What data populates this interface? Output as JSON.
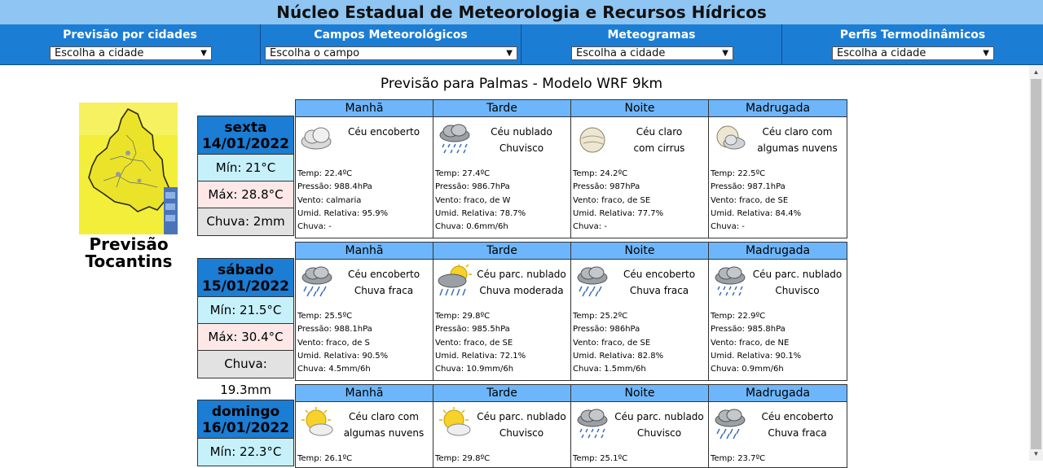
{
  "header": {
    "title": "Núcleo Estadual de Meteorologia e Recursos Hídricos"
  },
  "menu": [
    {
      "label": "Previsão por cidades",
      "select": "Escolha a cidade"
    },
    {
      "label": "Campos Meteorológicos",
      "select": "Escolha o campo"
    },
    {
      "label": "Meteogramas",
      "select": "Escolha a cidade"
    },
    {
      "label": "Perfis Termodinâmicos",
      "select": "Escolha a cidade"
    }
  ],
  "page_title": "Previsão para Palmas -  Modelo WRF 9km",
  "logo": {
    "line1": "Previsão",
    "line2": "Tocantins"
  },
  "periods": [
    "Manhã",
    "Tarde",
    "Noite",
    "Madrugada"
  ],
  "days": [
    {
      "name": "sexta",
      "date": "14/01/2022",
      "min": "Mín: 21°C",
      "max": "Máx: 28.8°C",
      "rain": "Chuva: 2mm",
      "periods": [
        {
          "icon": "overcast-cloud-icon",
          "cond1": "Céu encoberto",
          "cond2": "",
          "temp": "Temp: 22.4ºC",
          "pressure": "Pressão: 988.4hPa",
          "wind": "Vento: calmaria",
          "humidity": "Umid. Relativa: 95.9%",
          "rain": "Chuva: -"
        },
        {
          "icon": "drizzle-cloud-icon",
          "cond1": "Céu nublado",
          "cond2": "Chuvisco",
          "temp": "Temp: 27.4ºC",
          "pressure": "Pressão: 986.7hPa",
          "wind": "Vento: fraco, de W",
          "humidity": "Umid. Relativa: 78.7%",
          "rain": "Chuva: 0.6mm/6h"
        },
        {
          "icon": "cirrus-night-icon",
          "cond1": "Céu claro",
          "cond2": "com cirrus",
          "temp": "Temp: 24.2ºC",
          "pressure": "Pressão: 987hPa",
          "wind": "Vento: fraco, de SE",
          "humidity": "Umid. Relativa: 77.7%",
          "rain": "Chuva: -"
        },
        {
          "icon": "few-clouds-night-icon",
          "cond1": "Céu claro com",
          "cond2": "algumas nuvens",
          "temp": "Temp: 22.5ºC",
          "pressure": "Pressão: 987.1hPa",
          "wind": "Vento: fraco, de SE",
          "humidity": "Umid. Relativa: 84.4%",
          "rain": "Chuva: -"
        }
      ]
    },
    {
      "name": "sábado",
      "date": "15/01/2022",
      "min": "Mín: 21.5°C",
      "max": "Máx: 30.4°C",
      "rain": "Chuva: 19.3mm",
      "periods": [
        {
          "icon": "light-rain-cloud-icon",
          "cond1": "Céu encoberto",
          "cond2": "Chuva fraca",
          "temp": "Temp: 25.5ºC",
          "pressure": "Pressão: 988.1hPa",
          "wind": "Vento: fraco, de S",
          "humidity": "Umid. Relativa: 90.5%",
          "rain": "Chuva: 4.5mm/6h"
        },
        {
          "icon": "sun-rain-cloud-icon",
          "cond1": "Céu parc. nublado",
          "cond2": "Chuva moderada",
          "temp": "Temp: 29.8ºC",
          "pressure": "Pressão: 985.5hPa",
          "wind": "Vento: fraco, de SE",
          "humidity": "Umid. Relativa: 72.1%",
          "rain": "Chuva: 10.9mm/6h"
        },
        {
          "icon": "light-rain-cloud-icon",
          "cond1": "Céu encoberto",
          "cond2": "Chuva fraca",
          "temp": "Temp: 25.2ºC",
          "pressure": "Pressão: 986hPa",
          "wind": "Vento: fraco, de SE",
          "humidity": "Umid. Relativa: 82.8%",
          "rain": "Chuva: 1.5mm/6h"
        },
        {
          "icon": "drizzle-cloud-icon",
          "cond1": "Céu parc. nublado",
          "cond2": "Chuvisco",
          "temp": "Temp: 22.9ºC",
          "pressure": "Pressão: 985.8hPa",
          "wind": "Vento: fraco, de NE",
          "humidity": "Umid. Relativa: 90.1%",
          "rain": "Chuva: 0.9mm/6h"
        }
      ]
    },
    {
      "name": "domingo",
      "date": "16/01/2022",
      "min": "Mín: 22.3°C",
      "max": "",
      "rain": "",
      "periods": [
        {
          "icon": "sun-cloud-icon",
          "cond1": "Céu claro com",
          "cond2": "algumas nuvens",
          "temp": "Temp: 26.1ºC",
          "pressure": "",
          "wind": "",
          "humidity": "",
          "rain": ""
        },
        {
          "icon": "sun-cloud-icon",
          "cond1": "Céu parc. nublado",
          "cond2": "Chuvisco",
          "temp": "Temp: 29.8ºC",
          "pressure": "",
          "wind": "",
          "humidity": "",
          "rain": ""
        },
        {
          "icon": "drizzle-cloud-icon",
          "cond1": "Céu parc. nublado",
          "cond2": "Chuvisco",
          "temp": "Temp: 25.1ºC",
          "pressure": "",
          "wind": "",
          "humidity": "",
          "rain": ""
        },
        {
          "icon": "light-rain-cloud-icon",
          "cond1": "Céu encoberto",
          "cond2": "Chuva fraca",
          "temp": "Temp: 23.7ºC",
          "pressure": "",
          "wind": "",
          "humidity": "",
          "rain": ""
        }
      ]
    }
  ]
}
